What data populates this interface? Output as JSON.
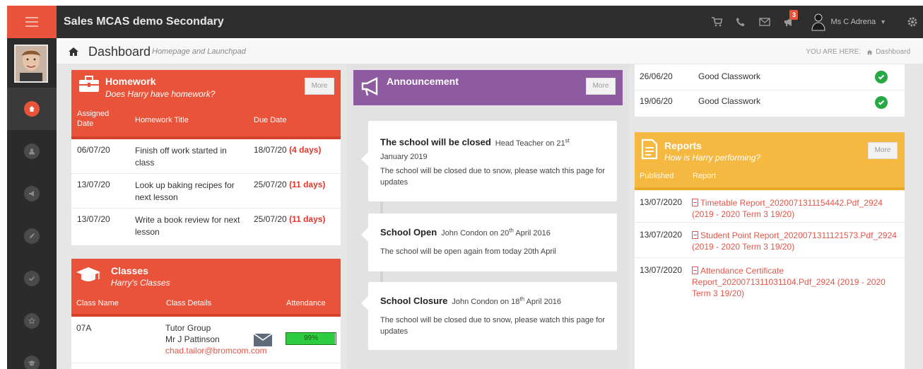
{
  "topbar": {
    "app_title": "Sales MCAS demo Secondary",
    "notification_count": "3",
    "user_name": "Ms C Adrena"
  },
  "page_header": {
    "title": "Dashboard",
    "subtitle": "Homepage and Launchpad",
    "breadcrumb_label": "YOU ARE HERE:",
    "breadcrumb_current": "Dashboard"
  },
  "homework": {
    "title": "Homework",
    "subtitle": "Does Harry have homework?",
    "more_label": "More",
    "col_assigned_1": "Assigned",
    "col_assigned_2": "Date",
    "col_title": "Homework Title",
    "col_due": "Due Date",
    "rows": [
      {
        "assigned": "06/07/20",
        "title": "Finish off work started in class",
        "due": "18/07/20",
        "days": "(4 days)"
      },
      {
        "assigned": "13/07/20",
        "title": "Look up baking recipes for next lesson",
        "due": "25/07/20",
        "days": "(11 days)"
      },
      {
        "assigned": "13/07/20",
        "title": "Write a book review for next lesson",
        "due": "25/07/20",
        "days": "(11 days)"
      }
    ]
  },
  "classes": {
    "title": "Classes",
    "subtitle": "Harry's Classes",
    "col_name": "Class Name",
    "col_details": "Class Details",
    "col_attendance": "Attendance",
    "rows": [
      {
        "name": "07A",
        "group": "Tutor Group",
        "teacher": "Mr J Pattinson",
        "email": "chad.tailor@bromcom.com",
        "attendance": "99%",
        "attendance_fraction": 0.99
      }
    ]
  },
  "announcement": {
    "title": "Announcement",
    "more_label": "More",
    "items": [
      {
        "title": "The school will be closed",
        "meta_pre": "Head Teacher on 21",
        "meta_sup": "st",
        "meta_post": "January 2019",
        "body": "The school will be closed due to snow, please watch this page for updates"
      },
      {
        "title": "School Open",
        "meta_pre": "John Condon on 20",
        "meta_sup": "th",
        "meta_post": " April 2016",
        "body": "The school will be open again from today 20th April"
      },
      {
        "title": "School Closure",
        "meta_pre": "John Condon on 18",
        "meta_sup": "th",
        "meta_post": " April 2016",
        "body": "The school will be closed due to snow, please watch this page for updates"
      }
    ]
  },
  "achievements": {
    "rows": [
      {
        "date": "26/06/20",
        "label": "Good Classwork"
      },
      {
        "date": "19/06/20",
        "label": "Good Classwork"
      }
    ]
  },
  "reports": {
    "title": "Reports",
    "subtitle": "How is Harry performing?",
    "more_label": "More",
    "col_published": "Published",
    "col_report": "Report",
    "rows": [
      {
        "date": "13/07/2020",
        "line1": "Timetable Report_2020071311154442.Pdf_2924",
        "line2": "(2019 - 2020 Term 3 19/20)",
        "line3": ""
      },
      {
        "date": "13/07/2020",
        "line1": "Student Point Report_2020071311121573.Pdf_2924",
        "line2": "(2019 - 2020 Term 3 19/20)",
        "line3": ""
      },
      {
        "date": "13/07/2020",
        "line1": "Attendance Certificate",
        "line2": "Report_2020071311031104.Pdf_2924 (2019 - 2020",
        "line3": "Term 3 19/20)"
      }
    ]
  },
  "colors": {
    "accent_red": "#e8533a",
    "announcement_purple": "#8e5aa0",
    "reports_yellow": "#f5b942",
    "success_green": "#27a844"
  }
}
